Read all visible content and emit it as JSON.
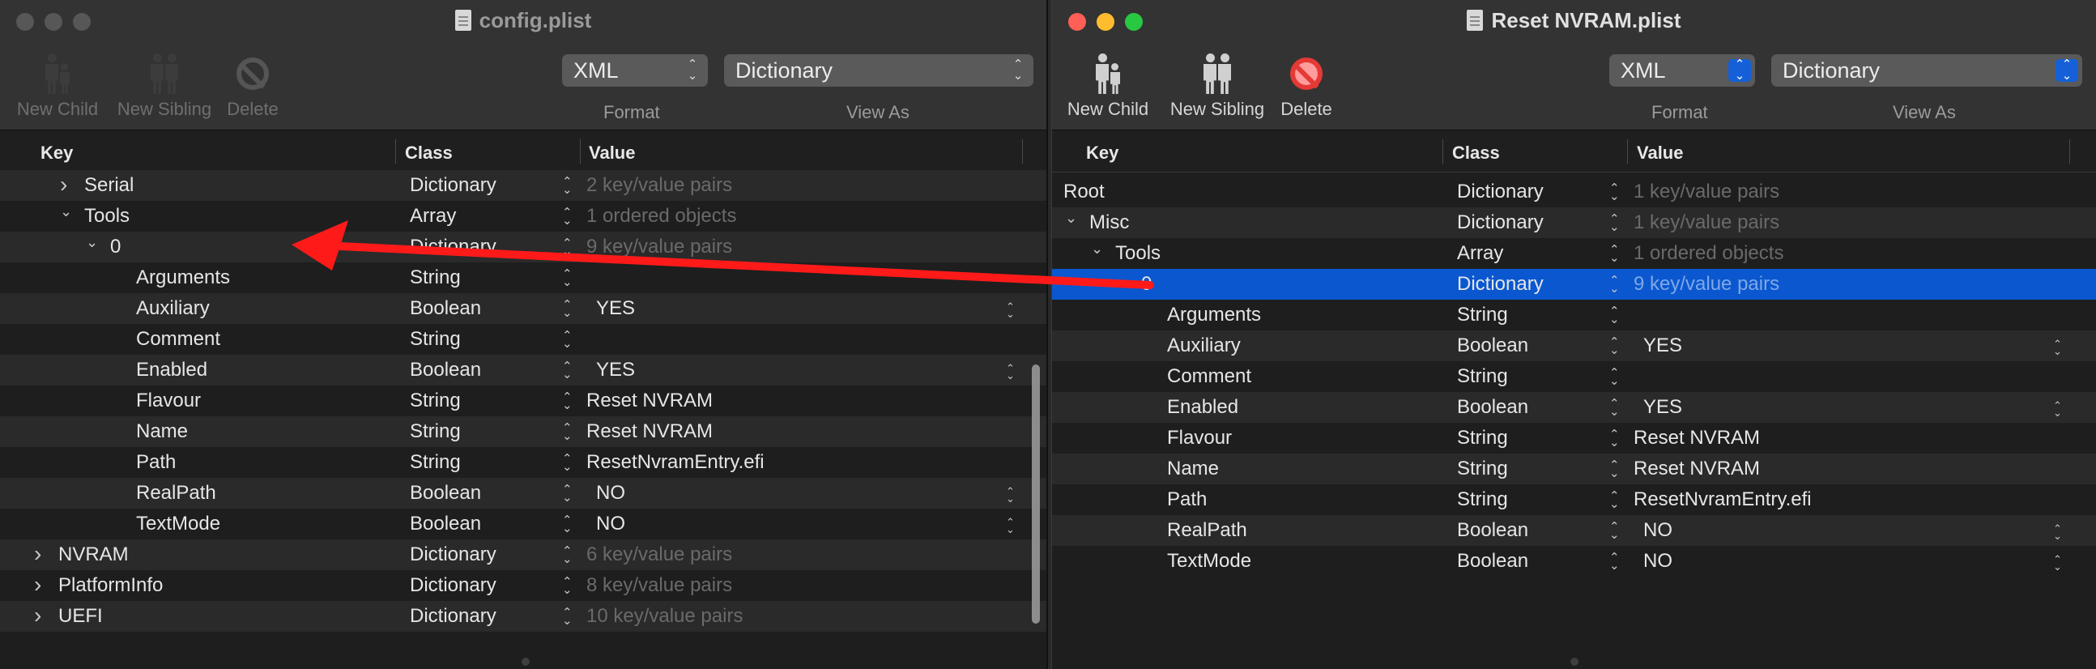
{
  "windows": [
    {
      "title": "config.plist",
      "active": false,
      "toolbar": {
        "new_child": "New Child",
        "new_sibling": "New Sibling",
        "delete": "Delete",
        "format_value": "XML",
        "format_label": "Format",
        "view_value": "Dictionary",
        "view_label": "View As"
      },
      "columns": [
        "Key",
        "Class",
        "Value"
      ],
      "rows": [
        {
          "key": "Serial",
          "cls": "Dictionary",
          "value": "2 key/value pairs",
          "disclosure": "collapsed",
          "indent": 1
        },
        {
          "key": "Tools",
          "cls": "Array",
          "value": "1 ordered objects",
          "disclosure": "expanded",
          "indent": 1
        },
        {
          "key": "0",
          "cls": "Dictionary",
          "value": "9 key/value pairs",
          "disclosure": "expanded",
          "indent": 2
        },
        {
          "key": "Arguments",
          "cls": "String",
          "value": "",
          "indent": 3
        },
        {
          "key": "Auxiliary",
          "cls": "Boolean",
          "value": "YES",
          "indent": 3
        },
        {
          "key": "Comment",
          "cls": "String",
          "value": "",
          "indent": 3
        },
        {
          "key": "Enabled",
          "cls": "Boolean",
          "value": "YES",
          "indent": 3
        },
        {
          "key": "Flavour",
          "cls": "String",
          "value": "Reset NVRAM",
          "indent": 3
        },
        {
          "key": "Name",
          "cls": "String",
          "value": "Reset NVRAM",
          "indent": 3
        },
        {
          "key": "Path",
          "cls": "String",
          "value": "ResetNvramEntry.efi",
          "indent": 3
        },
        {
          "key": "RealPath",
          "cls": "Boolean",
          "value": "NO",
          "indent": 3
        },
        {
          "key": "TextMode",
          "cls": "Boolean",
          "value": "NO",
          "indent": 3
        },
        {
          "key": "NVRAM",
          "cls": "Dictionary",
          "value": "6 key/value pairs",
          "disclosure": "collapsed",
          "indent": 0
        },
        {
          "key": "PlatformInfo",
          "cls": "Dictionary",
          "value": "8 key/value pairs",
          "disclosure": "collapsed",
          "indent": 0
        },
        {
          "key": "UEFI",
          "cls": "Dictionary",
          "value": "10 key/value pairs",
          "disclosure": "collapsed",
          "indent": 0
        }
      ]
    },
    {
      "title": "Reset NVRAM.plist",
      "active": true,
      "toolbar": {
        "new_child": "New Child",
        "new_sibling": "New Sibling",
        "delete": "Delete",
        "format_value": "XML",
        "format_label": "Format",
        "view_value": "Dictionary",
        "view_label": "View As"
      },
      "columns": [
        "Key",
        "Class",
        "Value"
      ],
      "rows": [
        {
          "key": "Root",
          "cls": "Dictionary",
          "value": "1 key/value pairs",
          "disclosure": "expanded",
          "indent": 0
        },
        {
          "key": "Misc",
          "cls": "Dictionary",
          "value": "1 key/value pairs",
          "disclosure": "expanded",
          "indent": 1
        },
        {
          "key": "Tools",
          "cls": "Array",
          "value": "1 ordered objects",
          "disclosure": "expanded",
          "indent": 2
        },
        {
          "key": "0",
          "cls": "Dictionary",
          "value": "9 key/value pairs",
          "disclosure": "expanded",
          "indent": 3,
          "selected": true
        },
        {
          "key": "Arguments",
          "cls": "String",
          "value": "",
          "indent": 4
        },
        {
          "key": "Auxiliary",
          "cls": "Boolean",
          "value": "YES",
          "indent": 4
        },
        {
          "key": "Comment",
          "cls": "String",
          "value": "",
          "indent": 4
        },
        {
          "key": "Enabled",
          "cls": "Boolean",
          "value": "YES",
          "indent": 4
        },
        {
          "key": "Flavour",
          "cls": "String",
          "value": "Reset NVRAM",
          "indent": 4
        },
        {
          "key": "Name",
          "cls": "String",
          "value": "Reset NVRAM",
          "indent": 4
        },
        {
          "key": "Path",
          "cls": "String",
          "value": "ResetNvramEntry.efi",
          "indent": 4
        },
        {
          "key": "RealPath",
          "cls": "Boolean",
          "value": "NO",
          "indent": 4
        },
        {
          "key": "TextMode",
          "cls": "Boolean",
          "value": "NO",
          "indent": 4
        }
      ]
    }
  ],
  "colors": {
    "selection": "#0a57d0",
    "arrow": "#ff1a1a",
    "close": "#ff5f57",
    "minimize": "#febc2e",
    "zoom": "#28c840"
  }
}
